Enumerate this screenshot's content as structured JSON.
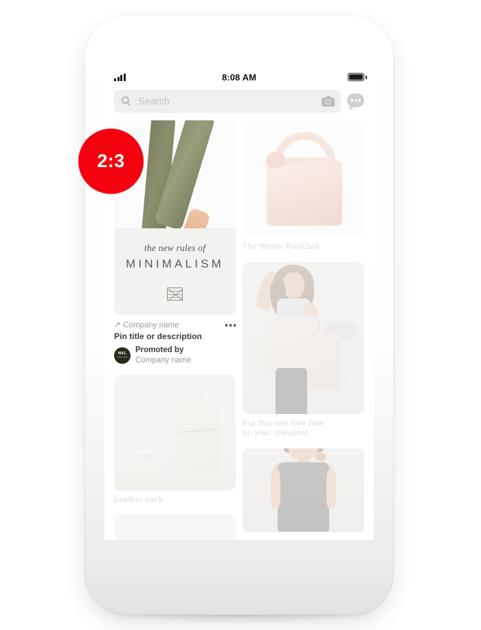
{
  "status_bar": {
    "signal_icon": "signal-bars-icon",
    "time": "8:08 AM",
    "battery_icon": "battery-full-icon"
  },
  "search": {
    "magnifier_icon": "search-icon",
    "placeholder": "Search",
    "camera_icon": "camera-icon",
    "messages_icon": "chat-bubble-icon"
  },
  "annotation": {
    "ratio_label": "2:3",
    "color": "#f5000f"
  },
  "promoted_pin": {
    "link_arrow_icon": "external-link-arrow-icon",
    "company_name": "Company name",
    "overflow_icon": "more-options-icon",
    "title": "Pin title or description",
    "avatar_text": "M&L",
    "avatar_sub": "SINCE 1981",
    "promoted_by_label": "Promoted by",
    "promoted_company": "Company name",
    "image": {
      "card_italic": "the new rules of",
      "card_caps": "MINIMALISM",
      "logo_icon": "envelope-crosshatch-logo-icon"
    }
  },
  "feed": {
    "left_column": [
      {
        "name": "pin-leather-sack",
        "caption": "Leather sack",
        "image": "white-sneakers-and-leather-sack"
      },
      {
        "name": "pin-partial-bottom-left",
        "caption": "",
        "image": "partial-pin-placeholder"
      }
    ],
    "right_column": [
      {
        "name": "pin-winter-rucksak",
        "caption": "The Winter RuckSak",
        "image": "pale-pink-hobo-bag"
      },
      {
        "name": "pin-one-size-tote",
        "caption": "Put this one size Tote on your shoulder",
        "caption_line1": "Put this one size Tote",
        "caption_line2": "on your shoulder",
        "image": "woman-holding-cream-tote"
      },
      {
        "name": "pin-gray-dress",
        "caption": "",
        "image": "woman-in-gray-sleeveless-dress"
      }
    ]
  },
  "colors": {
    "badge_red": "#f5000f",
    "search_field": "#efefef",
    "caption_gray": "#e6e6e6",
    "title_dark": "#3d3d3d",
    "meta_gray": "#9a9a9a",
    "avatar_dark": "#292a1e",
    "sandal_olive": "#4d5136",
    "pants_olive": "#8c8f6d",
    "bag_pink": "#f6e3dc"
  }
}
